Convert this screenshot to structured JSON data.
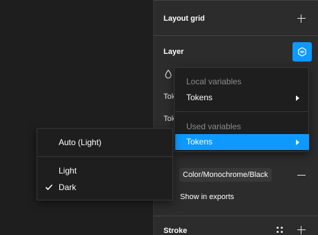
{
  "panel": {
    "layout_grid_title": "Layout grid",
    "layer_title": "Layer",
    "row1_label": "Toke",
    "row2_label": "Toke",
    "chip_value": "Color/Monochrome/Black",
    "show_in_exports": "Show in exports",
    "stroke_title": "Stroke"
  },
  "variables_menu": {
    "local_heading": "Local variables",
    "local_item": "Tokens",
    "used_heading": "Used variables",
    "used_item": "Tokens"
  },
  "mode_menu": {
    "items": [
      {
        "label": "Auto (Light)",
        "checked": false
      },
      {
        "label": "Light",
        "checked": false
      },
      {
        "label": "Dark",
        "checked": true
      }
    ]
  },
  "colors": {
    "accent": "#0d99ff",
    "panel_bg": "#2c2c2c",
    "canvas_bg": "#1e1e1e",
    "menu_bg": "#1e1e1e"
  },
  "icons": [
    "plus-icon",
    "hexagon-variables-icon",
    "drop-icon",
    "minus-icon",
    "dots-grid-icon",
    "chevron-right-icon",
    "check-icon"
  ]
}
